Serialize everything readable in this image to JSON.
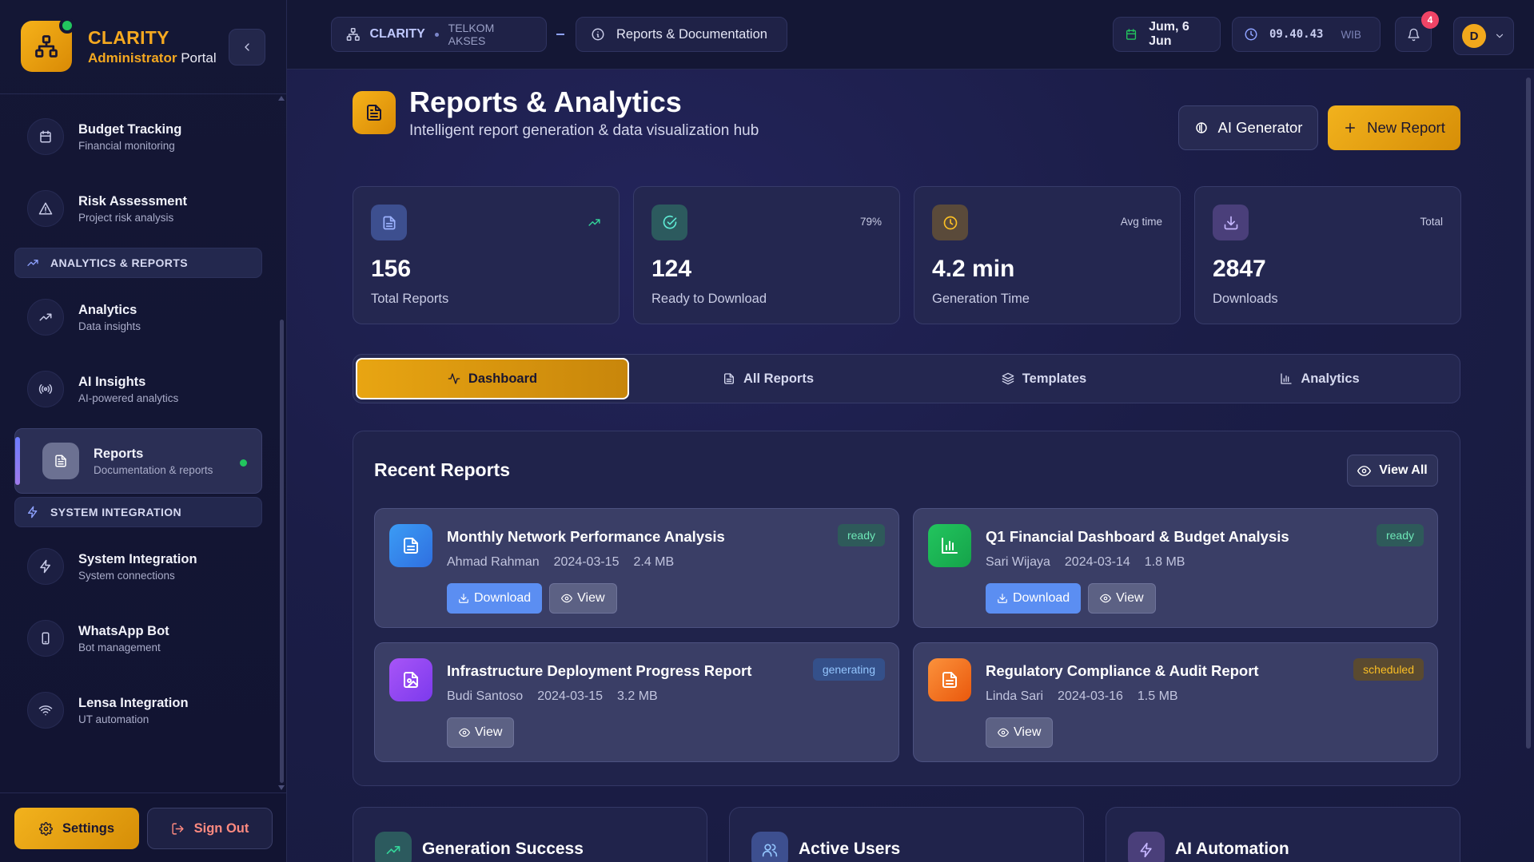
{
  "brand": {
    "name": "CLARITY",
    "subtitle_strong": "Administrator",
    "subtitle_rest": " Portal"
  },
  "sidebar": {
    "items_top": [
      {
        "title": "Budget Tracking",
        "sub": "Financial monitoring",
        "icon": "calendar-icon"
      },
      {
        "title": "Risk Assessment",
        "sub": "Project risk analysis",
        "icon": "warning-icon"
      }
    ],
    "section_analytics": "ANALYTICS & REPORTS",
    "items_analytics": [
      {
        "title": "Analytics",
        "sub": "Data insights",
        "icon": "trending-up-icon"
      },
      {
        "title": "AI Insights",
        "sub": "AI-powered analytics",
        "icon": "broadcast-icon"
      },
      {
        "title": "Reports",
        "sub": "Documentation & reports",
        "icon": "document-icon"
      }
    ],
    "section_system": "SYSTEM INTEGRATION",
    "items_system": [
      {
        "title": "System Integration",
        "sub": "System connections",
        "icon": "bolt-icon"
      },
      {
        "title": "WhatsApp Bot",
        "sub": "Bot management",
        "icon": "phone-icon"
      },
      {
        "title": "Lensa Integration",
        "sub": "UT automation",
        "icon": "wifi-icon"
      }
    ],
    "settings_label": "Settings",
    "signout_label": "Sign Out"
  },
  "topbar": {
    "crumb_brand": "CLARITY",
    "crumb_org": "TELKOM AKSES",
    "crumb_page": "Reports & Documentation",
    "date": "Jum, 6 Jun",
    "time": "09.40.43",
    "timezone": "WIB",
    "notifications": "4",
    "avatar_initial": "D"
  },
  "page": {
    "title": "Reports & Analytics",
    "subtitle": "Intelligent report generation & data visualization hub",
    "ai_button": "AI Generator",
    "new_button": "New Report"
  },
  "stats": [
    {
      "value": "156",
      "label": "Total Reports",
      "meta": "",
      "icon": "document-icon"
    },
    {
      "value": "124",
      "label": "Ready to Download",
      "meta": "79%",
      "icon": "check-circle-icon"
    },
    {
      "value": "4.2 min",
      "label": "Generation Time",
      "meta": "Avg time",
      "icon": "clock-icon"
    },
    {
      "value": "2847",
      "label": "Downloads",
      "meta": "Total",
      "icon": "download-icon"
    }
  ],
  "tabs": [
    {
      "label": "Dashboard",
      "icon": "activity-icon"
    },
    {
      "label": "All Reports",
      "icon": "file-icon"
    },
    {
      "label": "Templates",
      "icon": "layers-icon"
    },
    {
      "label": "Analytics",
      "icon": "bar-chart-icon"
    }
  ],
  "recent": {
    "title": "Recent Reports",
    "view_all": "View All",
    "download_label": "Download",
    "view_label": "View",
    "reports": [
      {
        "title": "Monthly Network Performance Analysis",
        "author": "Ahmad Rahman",
        "date": "2024-03-15",
        "size": "2.4 MB",
        "status": "ready"
      },
      {
        "title": "Q1 Financial Dashboard & Budget Analysis",
        "author": "Sari Wijaya",
        "date": "2024-03-14",
        "size": "1.8 MB",
        "status": "ready"
      },
      {
        "title": "Infrastructure Deployment Progress Report",
        "author": "Budi Santoso",
        "date": "2024-03-15",
        "size": "3.2 MB",
        "status": "generating"
      },
      {
        "title": "Regulatory Compliance & Audit Report",
        "author": "Linda Sari",
        "date": "2024-03-16",
        "size": "1.5 MB",
        "status": "scheduled"
      }
    ]
  },
  "bottom_cards": [
    {
      "title": "Generation Success",
      "icon": "trending-up-icon"
    },
    {
      "title": "Active Users",
      "icon": "users-icon"
    },
    {
      "title": "AI Automation",
      "icon": "bolt-icon"
    }
  ],
  "colors": {
    "accent": "#f4a820",
    "success": "#22c55e",
    "info": "#5b8ef2",
    "danger": "#ef4466"
  }
}
